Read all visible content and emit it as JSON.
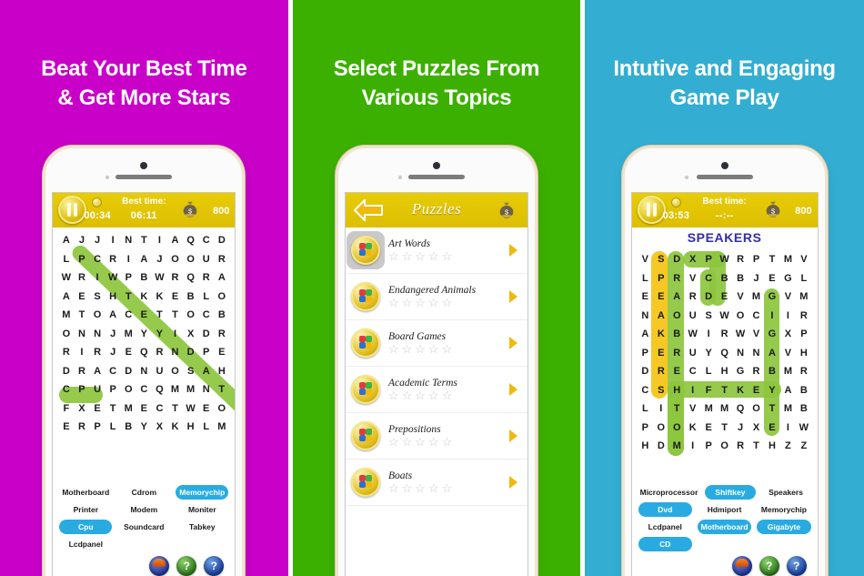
{
  "panels": [
    {
      "background": "#c800c8",
      "headline_line1": "Beat Your Best Time",
      "headline_line2": "& Get More Stars"
    },
    {
      "background": "#3cb000",
      "headline_line1": "Select Puzzles From",
      "headline_line2": "Various Topics"
    },
    {
      "background": "#33aed2",
      "headline_line1": "Intutive and Engaging",
      "headline_line2": "Game Play"
    }
  ],
  "game1": {
    "timer": "00:34",
    "best_time_label": "Best time:",
    "best_time_value": "06:11",
    "coins": "800",
    "grid": [
      [
        "A",
        "J",
        "J",
        "I",
        "N",
        "T",
        "I",
        "A",
        "Q",
        "C",
        "D"
      ],
      [
        "L",
        "P",
        "C",
        "R",
        "I",
        "A",
        "J",
        "O",
        "O",
        "U",
        "R"
      ],
      [
        "W",
        "R",
        "I",
        "W",
        "P",
        "B",
        "W",
        "R",
        "Q",
        "R",
        "A"
      ],
      [
        "A",
        "E",
        "S",
        "H",
        "T",
        "K",
        "K",
        "E",
        "B",
        "L",
        "O"
      ],
      [
        "M",
        "T",
        "O",
        "A",
        "C",
        "E",
        "T",
        "T",
        "O",
        "C",
        "B"
      ],
      [
        "O",
        "N",
        "N",
        "J",
        "M",
        "Y",
        "Y",
        "I",
        "X",
        "D",
        "R"
      ],
      [
        "R",
        "I",
        "R",
        "J",
        "E",
        "Q",
        "R",
        "N",
        "D",
        "P",
        "E"
      ],
      [
        "D",
        "R",
        "A",
        "C",
        "D",
        "N",
        "U",
        "O",
        "S",
        "A",
        "H"
      ],
      [
        "C",
        "P",
        "U",
        "P",
        "O",
        "C",
        "Q",
        "M",
        "M",
        "N",
        "T"
      ],
      [
        "F",
        "X",
        "E",
        "T",
        "M",
        "E",
        "C",
        "T",
        "W",
        "E",
        "O"
      ],
      [
        "E",
        "R",
        "P",
        "L",
        "B",
        "Y",
        "X",
        "K",
        "H",
        "L",
        "M"
      ]
    ],
    "words": [
      {
        "label": "Motherboard",
        "found": false
      },
      {
        "label": "Cdrom",
        "found": false
      },
      {
        "label": "Memorychip",
        "found": true
      },
      {
        "label": "Printer",
        "found": false
      },
      {
        "label": "Modem",
        "found": false
      },
      {
        "label": "Moniter",
        "found": false
      },
      {
        "label": "Cpu",
        "found": true
      },
      {
        "label": "Soundcard",
        "found": false
      },
      {
        "label": "Tabkey",
        "found": false
      },
      {
        "label": "Lcdpanel",
        "found": false
      },
      {
        "label": "",
        "found": false
      },
      {
        "label": "",
        "found": false
      }
    ],
    "actions": [
      "hint-icon",
      "help-icon",
      "info-icon"
    ]
  },
  "puzzles_screen": {
    "title": "Puzzles",
    "back_icon": "back-arrow-icon",
    "coin_icon": "money-bag-icon",
    "items": [
      {
        "name": "Art Words",
        "stars": 0,
        "selected": true
      },
      {
        "name": "Endangered Animals",
        "stars": 0,
        "selected": false
      },
      {
        "name": "Board Games",
        "stars": 0,
        "selected": false
      },
      {
        "name": "Academic Terms",
        "stars": 0,
        "selected": false
      },
      {
        "name": "Prepositions",
        "stars": 0,
        "selected": false
      },
      {
        "name": "Boats",
        "stars": 0,
        "selected": false
      }
    ],
    "star_glyph": "☆",
    "max_stars": 5
  },
  "game3": {
    "timer": "03:53",
    "best_time_label": "Best time:",
    "best_time_value": "--:--",
    "coins": "800",
    "puzzle_title": "SPEAKERS",
    "grid": [
      [
        "V",
        "S",
        "D",
        "X",
        "P",
        "W",
        "R",
        "P",
        "T",
        "M",
        "V"
      ],
      [
        "L",
        "P",
        "R",
        "V",
        "C",
        "B",
        "B",
        "J",
        "E",
        "G",
        "L"
      ],
      [
        "E",
        "E",
        "A",
        "R",
        "D",
        "E",
        "V",
        "M",
        "G",
        "V",
        "M"
      ],
      [
        "N",
        "A",
        "O",
        "U",
        "S",
        "W",
        "O",
        "C",
        "I",
        "I",
        "R"
      ],
      [
        "A",
        "K",
        "B",
        "W",
        "I",
        "R",
        "W",
        "V",
        "G",
        "X",
        "P"
      ],
      [
        "P",
        "E",
        "R",
        "U",
        "Y",
        "Q",
        "N",
        "N",
        "A",
        "V",
        "H"
      ],
      [
        "D",
        "R",
        "E",
        "C",
        "L",
        "H",
        "G",
        "R",
        "B",
        "M",
        "R"
      ],
      [
        "C",
        "S",
        "H",
        "I",
        "F",
        "T",
        "K",
        "E",
        "Y",
        "A",
        "B"
      ],
      [
        "L",
        "I",
        "T",
        "V",
        "M",
        "M",
        "Q",
        "O",
        "T",
        "M",
        "B"
      ],
      [
        "P",
        "O",
        "O",
        "K",
        "E",
        "T",
        "J",
        "X",
        "E",
        "I",
        "W"
      ],
      [
        "H",
        "D",
        "M",
        "I",
        "P",
        "O",
        "R",
        "T",
        "H",
        "Z",
        "Z"
      ]
    ],
    "words": [
      {
        "label": "Microprocessor",
        "found": false
      },
      {
        "label": "Shiftkey",
        "found": true
      },
      {
        "label": "Speakers",
        "found": false
      },
      {
        "label": "Dvd",
        "found": true
      },
      {
        "label": "Hdmiport",
        "found": false
      },
      {
        "label": "Memorychip",
        "found": false
      },
      {
        "label": "Lcdpanel",
        "found": false
      },
      {
        "label": "Motherboard",
        "found": true
      },
      {
        "label": "Gigabyte",
        "found": true
      },
      {
        "label": "CD",
        "found": true
      },
      {
        "label": "",
        "found": false
      },
      {
        "label": "",
        "found": false
      }
    ],
    "actions": [
      "hint-icon",
      "help-icon",
      "info-icon"
    ]
  },
  "colors": {
    "panel1": "#c800c8",
    "panel2": "#3cb000",
    "panel3": "#33aed2",
    "gamebar": "#e2c505",
    "found_word": "#29abe2",
    "highlight_green": "#8cc63e",
    "highlight_yellow": "#f4c312",
    "puzzle_title": "#2f2fa8"
  }
}
